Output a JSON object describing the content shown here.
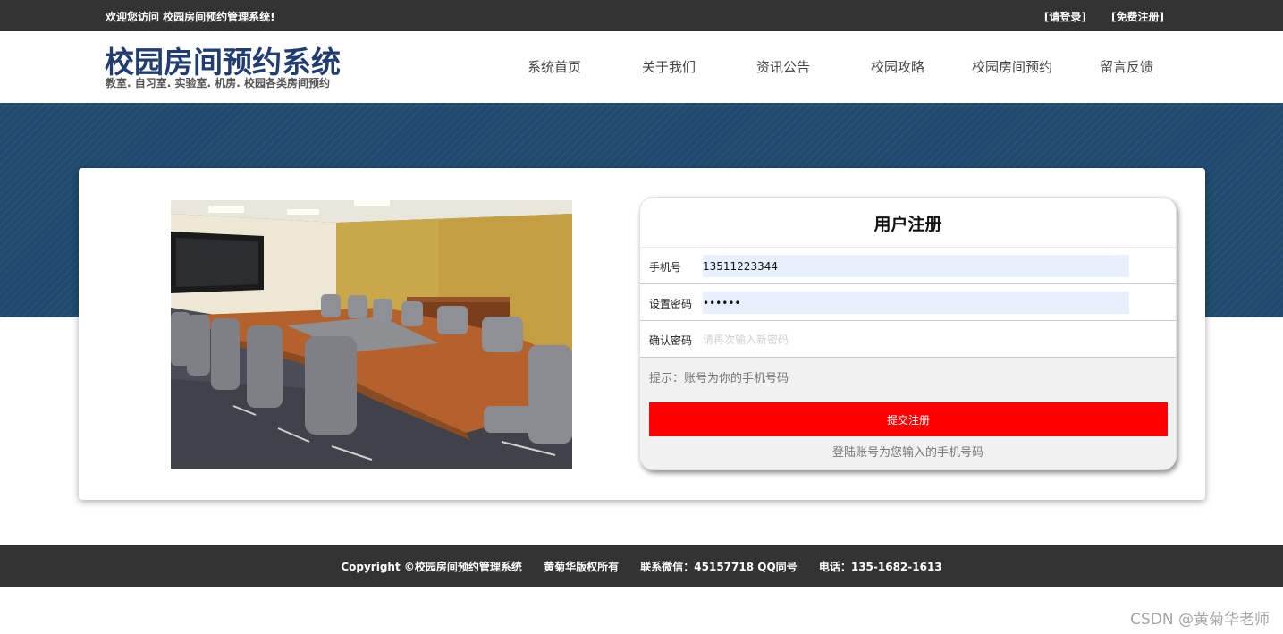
{
  "topbar": {
    "welcome": "欢迎您访问 校园房间预约管理系统!",
    "login_link": "[请登录]",
    "register_link": "[免费注册]"
  },
  "header": {
    "title": "校园房间预约系统",
    "subtitle": "教室. 自习室. 实验室. 机房. 校园各类房间预约",
    "nav": [
      {
        "label": "系统首页"
      },
      {
        "label": "关于我们"
      },
      {
        "label": "资讯公告"
      },
      {
        "label": "校园攻略"
      },
      {
        "label": "校园房间预约"
      },
      {
        "label": "留言反馈"
      }
    ]
  },
  "register": {
    "title": "用户注册",
    "phone_label": "手机号",
    "phone_value": "13511223344",
    "password_label": "设置密码",
    "password_value": "123456",
    "confirm_label": "确认密码",
    "confirm_placeholder": "请再次输入新密码",
    "hint": "提示：账号为你的手机号码",
    "submit_label": "提交注册",
    "note": "登陆账号为您输入的手机号码"
  },
  "footer": {
    "copyright": "Copyright ©校园房间预约管理系统",
    "rights": "黄菊华版权所有",
    "wechat": "联系微信：45157718 QQ同号",
    "phone": "电话：135-1682-1613"
  },
  "watermark": "CSDN @黄菊华老师",
  "colors": {
    "topbar": "#333333",
    "title": "#203c71",
    "banner": "#1f4a6e",
    "submit": "#ff0000"
  }
}
